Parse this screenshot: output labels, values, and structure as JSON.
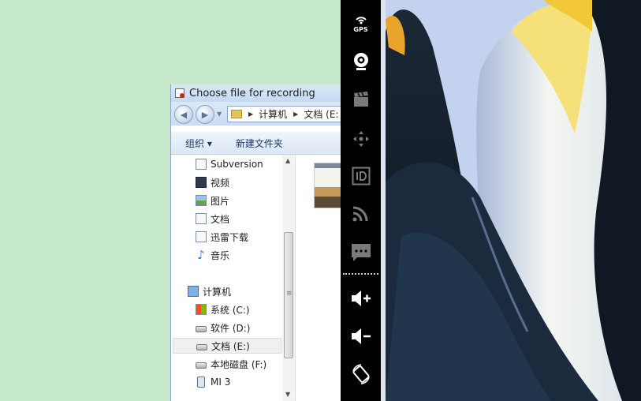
{
  "dialog": {
    "title": "Choose file for recording",
    "breadcrumb": [
      "计算机",
      "文档 (E:"
    ],
    "toolbar": {
      "organize_label": "组织 ▾",
      "new_folder_label": "新建文件夹"
    },
    "tree": [
      {
        "label": "Subversion",
        "icon": "document-icon"
      },
      {
        "label": "视频",
        "icon": "video-icon"
      },
      {
        "label": "图片",
        "icon": "picture-icon"
      },
      {
        "label": "文档",
        "icon": "document-icon"
      },
      {
        "label": "迅雷下载",
        "icon": "document-icon"
      },
      {
        "label": "音乐",
        "icon": "music-icon"
      },
      {
        "label": "计算机",
        "icon": "computer-icon"
      },
      {
        "label": "系统 (C:)",
        "icon": "system-drive-icon"
      },
      {
        "label": "软件 (D:)",
        "icon": "drive-icon"
      },
      {
        "label": "文档 (E:)",
        "icon": "drive-icon",
        "selected": true
      },
      {
        "label": "本地磁盘 (F:)",
        "icon": "drive-icon"
      },
      {
        "label": "MI 3",
        "icon": "phone-icon"
      }
    ]
  },
  "control_bar": {
    "gps_label": "GPS",
    "buttons": [
      "gps-icon",
      "webcam-icon",
      "clapperboard-icon",
      "dpad-icon",
      "id-icon",
      "rss-icon",
      "chat-icon",
      "volume-up-icon",
      "volume-down-icon",
      "rotate-icon"
    ]
  },
  "colors": {
    "desktop_bg": "#c6eacb",
    "control_bar_bg": "#000000",
    "dialog_chrome": "#c5d9f1"
  }
}
